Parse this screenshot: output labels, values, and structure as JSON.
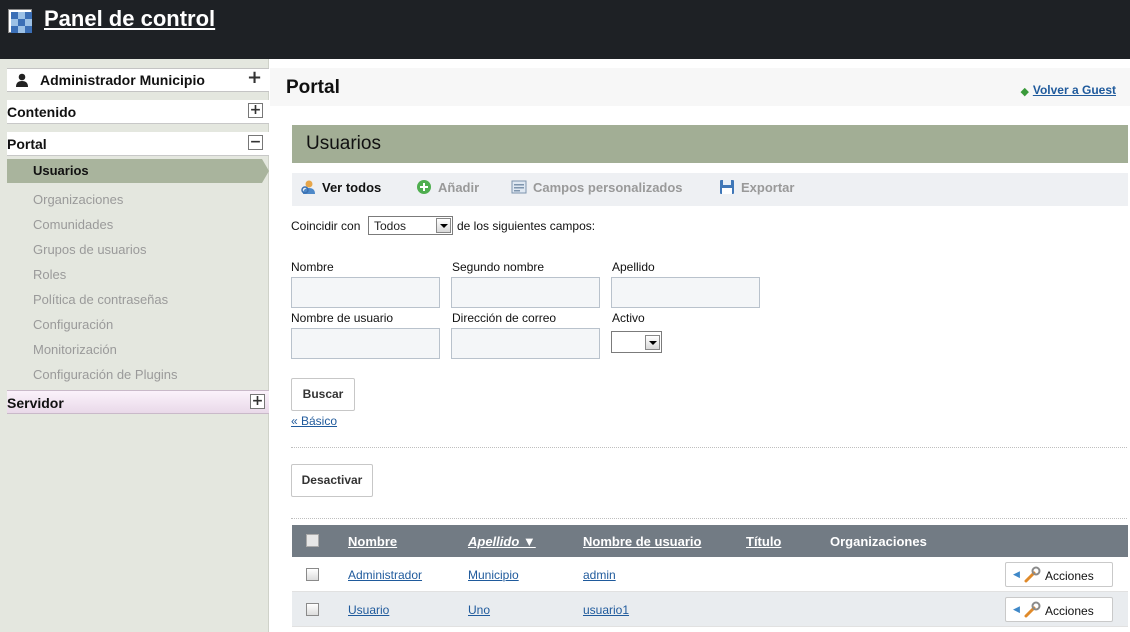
{
  "header": {
    "title": "Panel de control"
  },
  "sidebar": {
    "top": {
      "label": "Administrador Municipio"
    },
    "sections": [
      {
        "label": "Contenido",
        "toggle": "+"
      },
      {
        "label": "Portal",
        "toggle": "−"
      }
    ],
    "portal_items": [
      "Usuarios",
      "Organizaciones",
      "Comunidades",
      "Grupos de usuarios",
      "Roles",
      "Política de contraseñas",
      "Configuración",
      "Monitorización",
      "Configuración de Plugins"
    ],
    "active_item": "Usuarios",
    "server": {
      "label": "Servidor",
      "toggle": "+"
    }
  },
  "page": {
    "title": "Portal",
    "back_link": "Volver a Guest",
    "section_title": "Usuarios"
  },
  "toolbar": {
    "view_all": "Ver todos",
    "add": "Añadir",
    "custom_fields": "Campos personalizados",
    "export": "Exportar"
  },
  "search": {
    "match_prefix": "Coincidir con",
    "match_value": "Todos",
    "match_suffix": "de los siguientes campos:",
    "fields": {
      "first_name": "Nombre",
      "middle_name": "Segundo nombre",
      "last_name": "Apellido",
      "screen_name": "Nombre de usuario",
      "email": "Dirección de correo",
      "active": "Activo"
    },
    "search_button": "Buscar",
    "basic_link": "« Básico"
  },
  "deactivate_button": "Desactivar",
  "table": {
    "columns": [
      "Nombre",
      "Apellido ▼",
      "Nombre de usuario",
      "Título",
      "Organizaciones"
    ],
    "rows": [
      {
        "first_name": "Administrador",
        "last_name": "Municipio",
        "screen_name": "admin",
        "actions": "Acciones"
      },
      {
        "first_name": "Usuario",
        "last_name": "Uno",
        "screen_name": "usuario1",
        "actions": "Acciones"
      }
    ]
  },
  "colors": {
    "topbar": "#1e2125",
    "sidebar": "#e4e7df",
    "active_item": "#a9b49d",
    "section_band": "#a2ae95",
    "table_header": "#727b84",
    "link": "#1f5a9c"
  }
}
